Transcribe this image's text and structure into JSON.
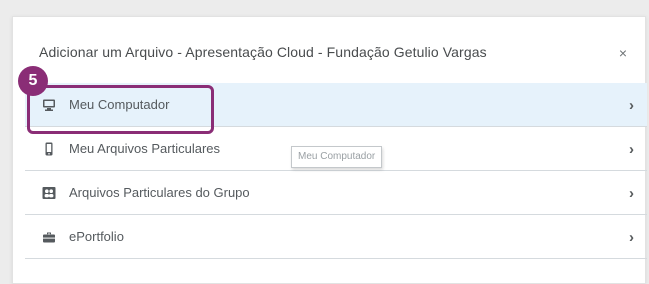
{
  "dialog": {
    "title": "Adicionar um Arquivo - Apresentação Cloud - Fundação Getulio Vargas",
    "close_label": "×"
  },
  "options": [
    {
      "label": "Meu Computador",
      "icon": "computer-icon",
      "chevron": "›",
      "selected": true
    },
    {
      "label": "Meu Arquivos Particulares",
      "icon": "phone-icon",
      "chevron": "›",
      "selected": false
    },
    {
      "label": "Arquivos Particulares do Grupo",
      "icon": "group-files-icon",
      "chevron": "›",
      "selected": false
    },
    {
      "label": "ePortfolio",
      "icon": "briefcase-icon",
      "chevron": "›",
      "selected": false
    }
  ],
  "annotation": {
    "step_number": "5",
    "color": "#8a2d76"
  },
  "tooltip": {
    "text": "Meu Computador"
  },
  "colors": {
    "selected_row_bg": "#e6f2fb",
    "divider": "#d5dade",
    "text": "#494c4e"
  }
}
